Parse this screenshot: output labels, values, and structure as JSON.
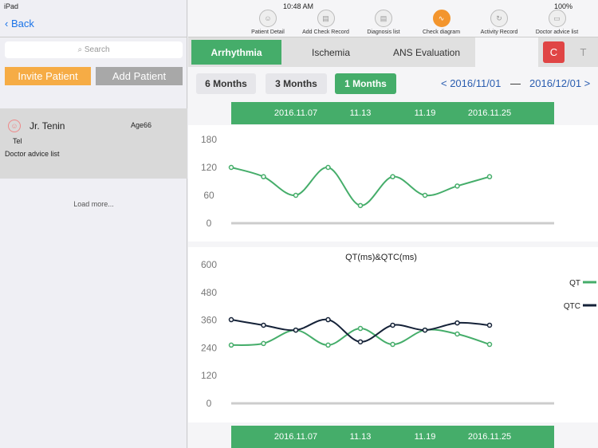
{
  "status": {
    "device": "iPad",
    "time": "10:48 AM",
    "battery": "100%"
  },
  "left": {
    "back": "Back",
    "search_placeholder": "Search",
    "invite": "Invite Patient",
    "add": "Add Patient",
    "patient": {
      "name": "Jr. Tenin",
      "age": "Age66",
      "tel": "Tel",
      "advice": "Doctor advice list"
    },
    "load_more": "Load more..."
  },
  "toolbar": [
    {
      "label": "Patient Detail",
      "icon": "person-icon"
    },
    {
      "label": "Add Check Record",
      "icon": "clipboard-add-icon"
    },
    {
      "label": "Diagnosis list",
      "icon": "clipboard-icon"
    },
    {
      "label": "Check diagram",
      "icon": "wave-icon",
      "active": true
    },
    {
      "label": "Activity Record",
      "icon": "refresh-icon"
    },
    {
      "label": "Doctor advice list",
      "icon": "chat-icon"
    }
  ],
  "tabs": [
    "Arrhythmia",
    "Ischemia",
    "ANS Evaluation"
  ],
  "ct": {
    "c": "C",
    "t": "T"
  },
  "ranges": [
    "6 Months",
    "3 Months",
    "1 Months"
  ],
  "date_range": {
    "start": "< 2016/11/01",
    "dash": "—",
    "end": "2016/12/01 >"
  },
  "date_labels": [
    "2016.11.07",
    "11.13",
    "11.19",
    "2016.11.25"
  ],
  "colors": {
    "green": "#45ad6a",
    "navy": "#152238",
    "orange": "#f6ac45",
    "red": "#e04545"
  },
  "chart_data": [
    {
      "type": "line",
      "ylim": [
        0,
        180
      ],
      "yticks": [
        0,
        60,
        120,
        180
      ],
      "x_tick_labels": [
        "2016.11.07",
        "11.13",
        "11.19",
        "2016.11.25"
      ],
      "series": [
        {
          "values": [
            120,
            100,
            60,
            120,
            38,
            100,
            60,
            80,
            100
          ],
          "color": "#45ad6a"
        }
      ]
    },
    {
      "type": "line",
      "title": "QT(ms)&QTC(ms)",
      "ylim": [
        0,
        600
      ],
      "yticks": [
        0,
        120,
        240,
        360,
        480,
        600
      ],
      "x_tick_labels": [
        "2016.11.07",
        "11.13",
        "11.19",
        "2016.11.25"
      ],
      "legend": "right",
      "series": [
        {
          "name": "QT",
          "values": [
            252,
            259,
            317,
            252,
            324,
            255,
            317,
            300,
            255
          ],
          "color": "#45ad6a"
        },
        {
          "name": "QTC",
          "values": [
            362,
            338,
            317,
            362,
            266,
            338,
            317,
            348,
            338
          ],
          "color": "#152238"
        }
      ]
    }
  ]
}
